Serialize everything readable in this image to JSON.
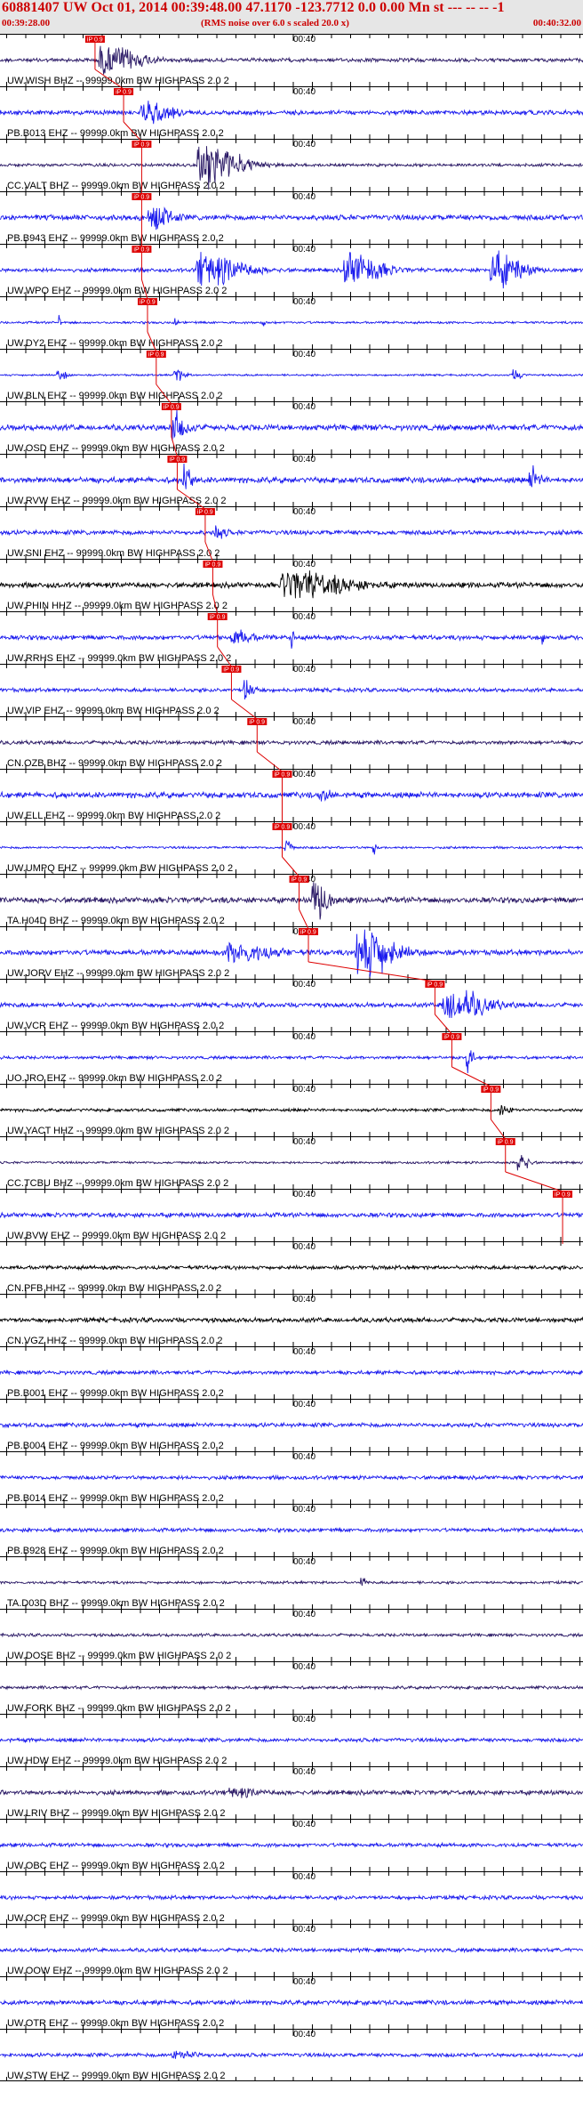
{
  "header": {
    "title": "60881407 UW Oct 01, 2014 00:39:48.00   47.1170 -123.7712  0.0 0.00 Mn st --- -- --  -1",
    "start_time": "00:39:28.00",
    "note": "(RMS noise over 6.0 s scaled 20.0 x)",
    "end_time": "00:40:32.00"
  },
  "tick_label": "00:40",
  "pick_label": "iP 0.9",
  "colors": {
    "blue": "#1a1aee",
    "black": "#000000",
    "purple": "#2b1a66",
    "pick": "#dd0000",
    "header_bg": "#e6e6e6"
  },
  "traces": [
    {
      "label": "UW.WISH BHZ -- 99999.0km BW  HIGHPASS  2.0  2",
      "color": "purple",
      "amp": 0.1,
      "pick": 0.163,
      "bursts": [
        [
          0.18,
          0.08,
          0.7
        ]
      ]
    },
    {
      "label": "PB.B013 EHZ -- 99999.0km BW  HIGHPASS  2.0  2",
      "color": "blue",
      "amp": 0.12,
      "pick": 0.212,
      "bursts": [
        [
          0.25,
          0.06,
          0.5
        ]
      ]
    },
    {
      "label": "CC.VALT BHZ -- 99999.0km BW  HIGHPASS  2.0  2",
      "color": "purple",
      "amp": 0.08,
      "pick": 0.243,
      "bursts": [
        [
          0.35,
          0.08,
          1.2
        ]
      ]
    },
    {
      "label": "PB.B943 EHZ -- 99999.0km BW  HIGHPASS  2.0  2",
      "color": "blue",
      "amp": 0.14,
      "pick": 0.243,
      "bursts": [
        [
          0.26,
          0.04,
          0.7
        ]
      ]
    },
    {
      "label": "UW.WPO EHZ -- 99999.0km BW  HIGHPASS  2.0  2",
      "color": "blue",
      "amp": 0.1,
      "pick": 0.243,
      "bursts": [
        [
          0.35,
          0.09,
          0.8
        ],
        [
          0.6,
          0.07,
          0.9
        ],
        [
          0.85,
          0.06,
          0.9
        ]
      ]
    },
    {
      "label": "UW.DY2 EHZ -- 99999.0km BW  HIGHPASS  2.0  2",
      "color": "blue",
      "amp": 0.06,
      "pick": 0.253,
      "bursts": [
        [
          0.1,
          0.005,
          0.4
        ],
        [
          0.3,
          0.005,
          0.3
        ],
        [
          0.45,
          0.005,
          0.3
        ]
      ]
    },
    {
      "label": "UW.BLN EHZ -- 99999.0km BW  HIGHPASS  2.0  2",
      "color": "blue",
      "amp": 0.05,
      "pick": 0.268,
      "bursts": [
        [
          0.1,
          0.02,
          0.25
        ],
        [
          0.3,
          0.02,
          0.35
        ],
        [
          0.88,
          0.02,
          0.25
        ]
      ]
    },
    {
      "label": "UW.OSD EHZ -- 99999.0km BW  HIGHPASS  2.0  2",
      "color": "blue",
      "amp": 0.15,
      "pick": 0.294,
      "bursts": [
        [
          0.3,
          0.03,
          0.7
        ]
      ]
    },
    {
      "label": "UW.RVW EHZ -- 99999.0km BW  HIGHPASS  2.0  2",
      "color": "blue",
      "amp": 0.15,
      "pick": 0.304,
      "bursts": [
        [
          0.315,
          0.015,
          1.0
        ],
        [
          0.91,
          0.02,
          0.6
        ]
      ]
    },
    {
      "label": "UW.SNI EHZ -- 99999.0km BW  HIGHPASS  2.0  2",
      "color": "blue",
      "amp": 0.12,
      "pick": 0.352,
      "bursts": [
        [
          0.37,
          0.02,
          0.35
        ]
      ]
    },
    {
      "label": "UW.PHIN HHZ -- 99999.0km BW  HIGHPASS  2.0  2",
      "color": "black",
      "amp": 0.14,
      "pick": 0.365,
      "bursts": [
        [
          0.5,
          0.12,
          0.7
        ]
      ]
    },
    {
      "label": "UW.RRHS EHZ -- 99999.0km BW  HIGHPASS  2.0  2",
      "color": "blue",
      "amp": 0.12,
      "pick": 0.373,
      "bursts": [
        [
          0.4,
          0.04,
          0.4
        ],
        [
          0.5,
          0.004,
          0.7
        ],
        [
          0.93,
          0.004,
          0.5
        ]
      ]
    },
    {
      "label": "UW.VIP EHZ -- 99999.0km BW  HIGHPASS  2.0  2",
      "color": "blue",
      "amp": 0.1,
      "pick": 0.397,
      "bursts": [
        [
          0.42,
          0.02,
          0.6
        ]
      ]
    },
    {
      "label": "CN.OZB BHZ -- 99999.0km BW  HIGHPASS  2.0  2",
      "color": "purple",
      "amp": 0.1,
      "pick": 0.441,
      "bursts": []
    },
    {
      "label": "UW.ELL EHZ -- 99999.0km BW  HIGHPASS  2.0  2",
      "color": "blue",
      "amp": 0.15,
      "pick": 0.484,
      "bursts": [
        [
          0.55,
          0.02,
          0.3
        ]
      ]
    },
    {
      "label": "UW.UMPQ EHZ -- 99999.0km BW  HIGHPASS  2.0  2",
      "color": "blue",
      "amp": 0.06,
      "pick": 0.484,
      "bursts": [
        [
          0.49,
          0.01,
          0.8
        ],
        [
          0.64,
          0.006,
          0.6
        ]
      ]
    },
    {
      "label": "TA.H04D BHZ -- 99999.0km BW  HIGHPASS  2.0  2",
      "color": "purple",
      "amp": 0.15,
      "pick": 0.513,
      "bursts": [
        [
          0.54,
          0.03,
          1.1
        ]
      ]
    },
    {
      "label": "UW.JORV EHZ -- 99999.0km BW  HIGHPASS  2.0  2",
      "color": "blue",
      "amp": 0.14,
      "pick": 0.529,
      "bursts": [
        [
          0.62,
          0.07,
          1.5
        ],
        [
          0.4,
          0.08,
          0.5
        ]
      ]
    },
    {
      "label": "UW.VCR EHZ -- 99999.0km BW  HIGHPASS  2.0  2",
      "color": "blue",
      "amp": 0.12,
      "pick": 0.746,
      "bursts": [
        [
          0.77,
          0.08,
          0.9
        ]
      ]
    },
    {
      "label": "UO.JRO EHZ -- 99999.0km BW  HIGHPASS  2.0  2",
      "color": "blue",
      "amp": 0.08,
      "pick": 0.775,
      "bursts": [
        [
          0.8,
          0.012,
          1.0
        ]
      ]
    },
    {
      "label": "UW.YACT HHZ -- 99999.0km BW  HIGHPASS  2.0  2",
      "color": "black",
      "amp": 0.08,
      "pick": 0.842,
      "bursts": [
        [
          0.86,
          0.02,
          0.35
        ]
      ]
    },
    {
      "label": "CC.TCBU BHZ -- 99999.0km BW  HIGHPASS  2.0  2",
      "color": "purple",
      "amp": 0.06,
      "pick": 0.867,
      "bursts": [
        [
          0.89,
          0.02,
          0.7
        ]
      ]
    },
    {
      "label": "UW.BVW EHZ -- 99999.0km BW  HIGHPASS  2.0  2",
      "color": "blue",
      "amp": 0.12,
      "pick": 0.965,
      "bursts": []
    },
    {
      "label": "CN.PFB HHZ -- 99999.0km BW  HIGHPASS  2.0  2",
      "color": "black",
      "amp": 0.1,
      "bursts": []
    },
    {
      "label": "CN.VGZ HHZ -- 99999.0km BW  HIGHPASS  2.0  2",
      "color": "black",
      "amp": 0.12,
      "bursts": []
    },
    {
      "label": "PB.B001 EHZ -- 99999.0km BW  HIGHPASS  2.0  2",
      "color": "blue",
      "amp": 0.1,
      "bursts": []
    },
    {
      "label": "PB.B004 EHZ -- 99999.0km BW  HIGHPASS  2.0  2",
      "color": "blue",
      "amp": 0.11,
      "bursts": []
    },
    {
      "label": "PB.B014 EHZ -- 99999.0km BW  HIGHPASS  2.0  2",
      "color": "blue",
      "amp": 0.1,
      "bursts": []
    },
    {
      "label": "PB.B928 EHZ -- 99999.0km BW  HIGHPASS  2.0  2",
      "color": "blue",
      "amp": 0.1,
      "bursts": []
    },
    {
      "label": "TA.D03D BHZ -- 99999.0km BW  HIGHPASS  2.0  2",
      "color": "purple",
      "amp": 0.07,
      "bursts": [
        [
          0.62,
          0.01,
          0.25
        ]
      ]
    },
    {
      "label": "UW.DOSE BHZ -- 99999.0km BW  HIGHPASS  2.0  2",
      "color": "purple",
      "amp": 0.08,
      "bursts": []
    },
    {
      "label": "UW.FORK BHZ -- 99999.0km BW  HIGHPASS  2.0  2",
      "color": "purple",
      "amp": 0.08,
      "bursts": []
    },
    {
      "label": "UW.HDW EHZ -- 99999.0km BW  HIGHPASS  2.0  2",
      "color": "blue",
      "amp": 0.1,
      "bursts": []
    },
    {
      "label": "UW.LRIV BHZ -- 99999.0km BW  HIGHPASS  2.0  2",
      "color": "purple",
      "amp": 0.12,
      "bursts": [
        [
          0.4,
          0.05,
          0.2
        ]
      ]
    },
    {
      "label": "UW.OBC EHZ -- 99999.0km BW  HIGHPASS  2.0  2",
      "color": "blue",
      "amp": 0.1,
      "bursts": []
    },
    {
      "label": "UW.OCP EHZ -- 99999.0km BW  HIGHPASS  2.0  2",
      "color": "blue",
      "amp": 0.1,
      "bursts": []
    },
    {
      "label": "UW.OOW EHZ -- 99999.0km BW  HIGHPASS  2.0  2",
      "color": "blue",
      "amp": 0.1,
      "bursts": []
    },
    {
      "label": "UW.OTR EHZ -- 99999.0km BW  HIGHPASS  2.0  2",
      "color": "blue",
      "amp": 0.12,
      "bursts": []
    },
    {
      "label": "UW.STW EHZ -- 99999.0km BW  HIGHPASS  2.0  2",
      "color": "blue",
      "amp": 0.1,
      "bursts": [
        [
          0.3,
          0.05,
          0.2
        ]
      ]
    }
  ]
}
